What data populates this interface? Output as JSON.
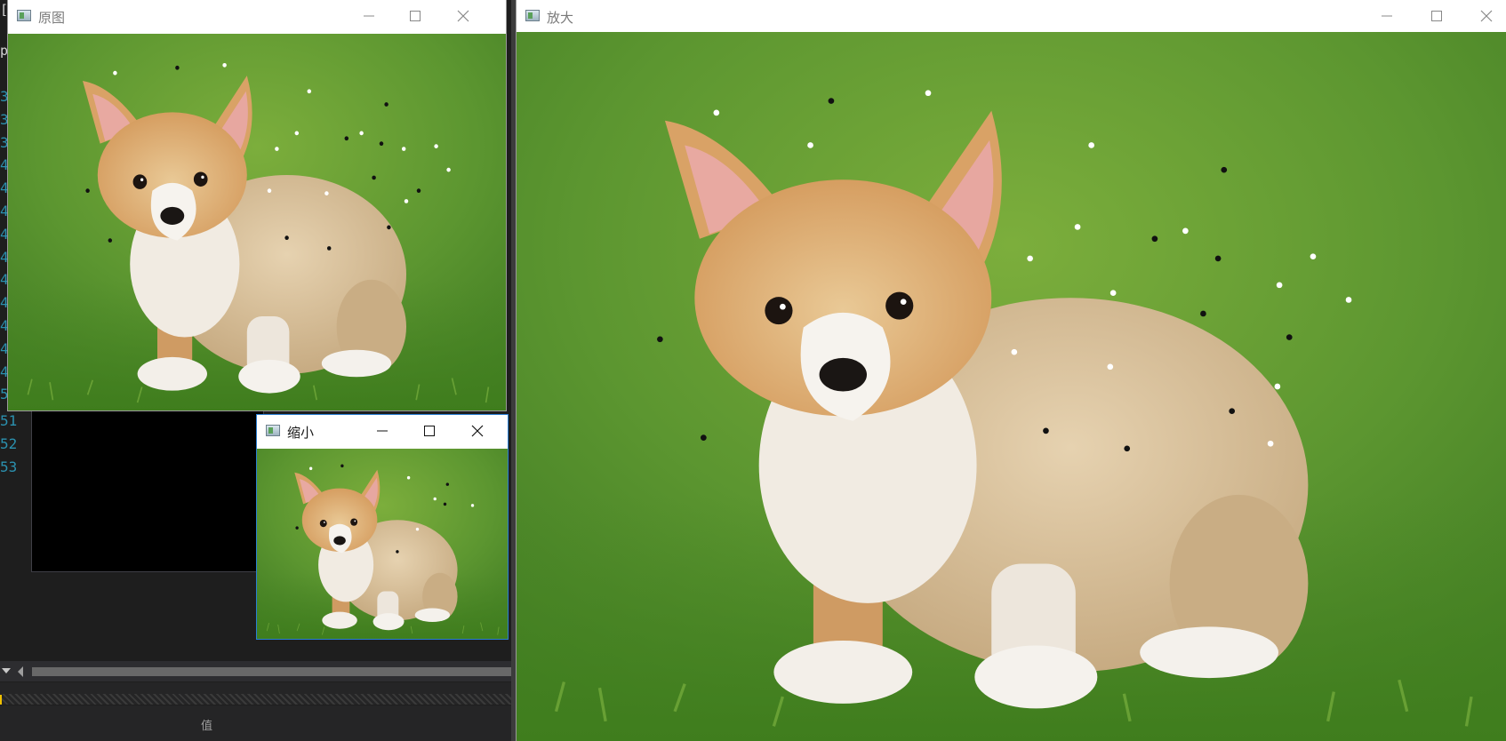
{
  "ide": {
    "edge_glyph": "p",
    "line_numbers": [
      "3",
      "3",
      "3",
      "4",
      "4",
      "4",
      "4",
      "4",
      "4",
      "4",
      "4",
      "4",
      "4",
      "5"
    ],
    "more_line_numbers": [
      "51",
      "52",
      "53"
    ],
    "footer_column_label": "值"
  },
  "windows": {
    "original": {
      "title": "原图",
      "active": false
    },
    "enlarged": {
      "title": "放大",
      "active": false
    },
    "shrink": {
      "title": "缩小",
      "active": true
    }
  },
  "colors": {
    "ide_background": "#1e1e1e",
    "line_number_blue": "#2b91af",
    "grass_green": "#5f9a2e",
    "active_window_border": "#2a7fd4"
  },
  "icons": [
    "window-app-icon",
    "minimize-icon",
    "maximize-icon",
    "close-icon"
  ]
}
